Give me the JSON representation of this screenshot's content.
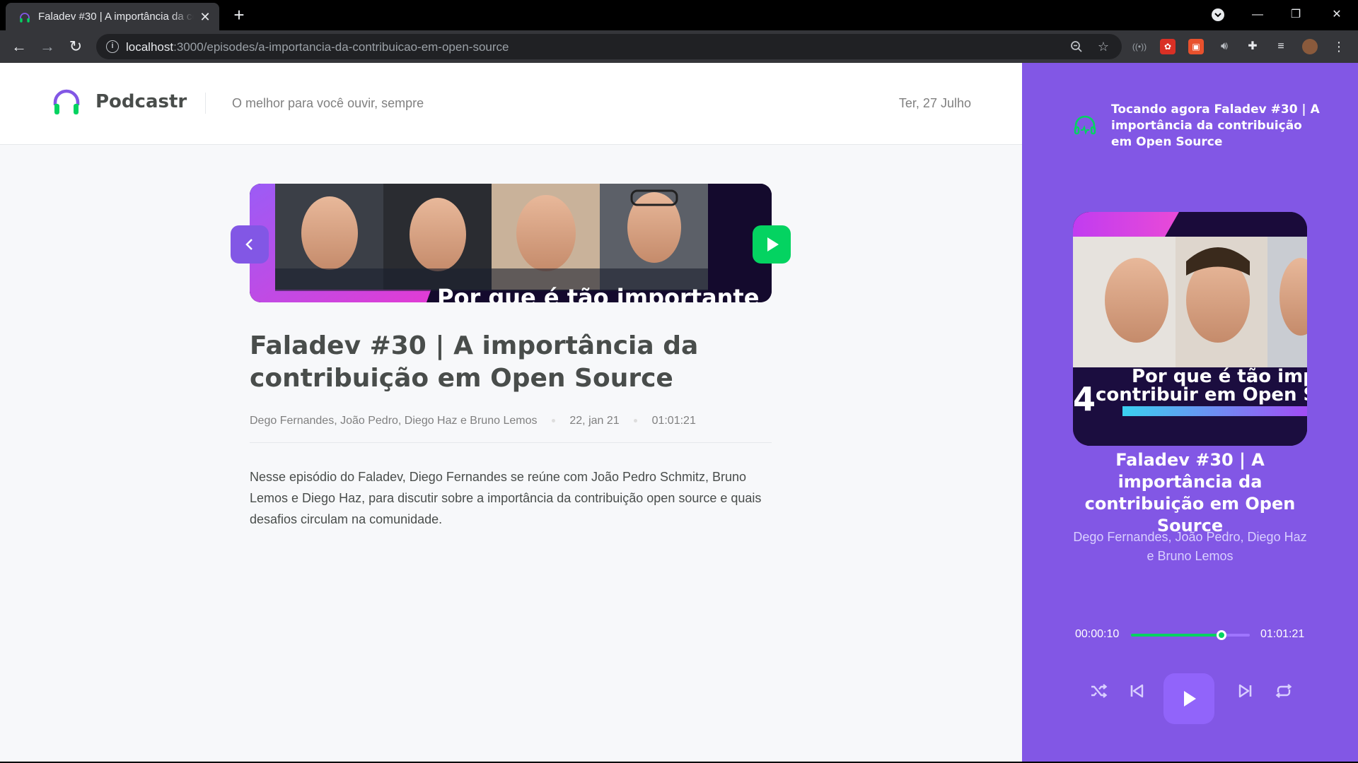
{
  "browser": {
    "tab_title": "Faladev #30 | A importância da contribuição em Open Source",
    "tab_close": "✕",
    "new_tab": "+",
    "url_host": "localhost",
    "url_path": ":3000/episodes/a-importancia-da-contribuicao-em-open-source",
    "win_minimize": "—",
    "win_restore": "❐",
    "win_close": "✕"
  },
  "header": {
    "brand": "Podcastr",
    "tagline": "O melhor para você ouvir, sempre",
    "date": "Ter, 27 Julho"
  },
  "episode": {
    "thumbnail_caption": "Por que é tão importante",
    "title": "Faladev #30 | A importância da contribuição em Open Source",
    "members": "Dego Fernandes, João Pedro, Diego Haz e Bruno Lemos",
    "published_at": "22, jan 21",
    "duration": "01:01:21",
    "description": "Nesse episódio do Faladev, Diego Fernandes se reúne com João Pedro Schmitz, Bruno Lemos e Diego Haz, para discutir sobre a importância da contribuição open source e quais desafios circulam na comunidade."
  },
  "player": {
    "now_playing": "Tocando agora Faladev #30 | A importância da contribuição em Open Source",
    "cover_caption_1": "Por que é tão imp",
    "cover_caption_2": "contribuir em Open S",
    "cover_number": "4",
    "title": "Faladev #30 | A importância da contribuição em Open Source",
    "members": "Dego Fernandes, João Pedro, Diego Haz e Bruno Lemos",
    "current_time": "00:00:10",
    "total_time": "01:01:21",
    "progress_percent": 76
  },
  "colors": {
    "purple": "#8257e5",
    "green": "#04d361",
    "text_dark": "#494d4b",
    "text_muted": "#808080"
  },
  "icons": [
    "headphones-icon",
    "back-arrow-icon",
    "play-icon",
    "shuffle-icon",
    "previous-icon",
    "next-icon",
    "repeat-icon"
  ]
}
